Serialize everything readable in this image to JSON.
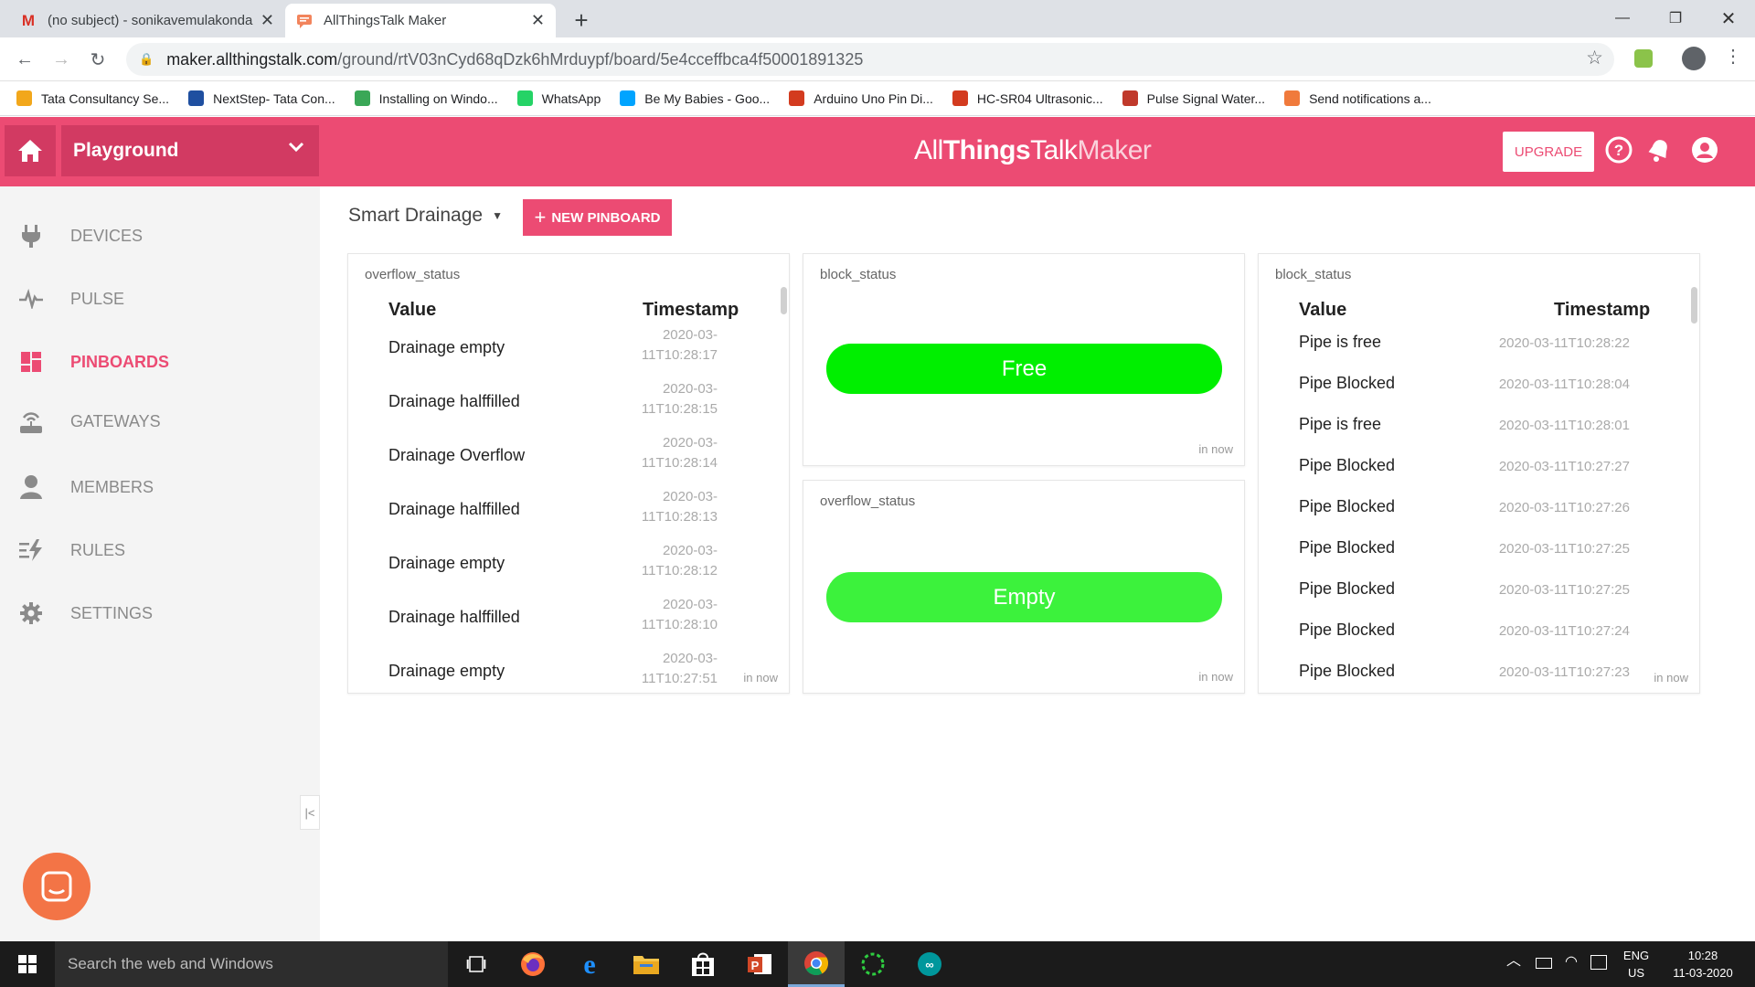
{
  "browser": {
    "tabs": [
      {
        "title": "(no subject) - sonikavemulakonda",
        "icon": "gmail-icon"
      },
      {
        "title": "AllThingsTalk Maker",
        "icon": "allthingstalk-icon"
      }
    ],
    "new_tab": "+",
    "url_host": "maker.allthingstalk.com",
    "url_path": "/ground/rtV03nCyd68qDzk6hMrduypf/board/5e4cceffbca4f50001891325",
    "bookmarks": [
      {
        "label": "Tata Consultancy Se...",
        "color": "#f2a71b"
      },
      {
        "label": "NextStep- Tata Con...",
        "color": "#1f4fa0"
      },
      {
        "label": "Installing on Windo...",
        "color": "#3aa757"
      },
      {
        "label": "WhatsApp",
        "color": "#25d366"
      },
      {
        "label": "Be My Babies - Goo...",
        "color": "#00a4ff"
      },
      {
        "label": "Arduino Uno Pin Di...",
        "color": "#d33b1f"
      },
      {
        "label": "HC-SR04 Ultrasonic...",
        "color": "#d33b1f"
      },
      {
        "label": "Pulse Signal Water...",
        "color": "#c0392b"
      },
      {
        "label": "Send notifications a...",
        "color": "#f07a3c"
      }
    ]
  },
  "header": {
    "ground": "Playground",
    "brand_a": "All",
    "brand_b": "Things",
    "brand_c": "Talk",
    "brand_d": "Maker",
    "upgrade": "UPGRADE",
    "accent": "#ec4b73"
  },
  "sidebar": {
    "items": [
      {
        "label": "DEVICES",
        "icon": "plug-icon"
      },
      {
        "label": "PULSE",
        "icon": "pulse-icon"
      },
      {
        "label": "PINBOARDS",
        "icon": "pinboards-icon"
      },
      {
        "label": "GATEWAYS",
        "icon": "gateway-icon"
      },
      {
        "label": "MEMBERS",
        "icon": "person-icon"
      },
      {
        "label": "RULES",
        "icon": "rules-icon"
      },
      {
        "label": "SETTINGS",
        "icon": "gear-icon"
      }
    ],
    "collapse": "|<"
  },
  "board": {
    "name": "Smart Drainage",
    "new_pinboard": "NEW PINBOARD"
  },
  "cards": {
    "overflow_table": {
      "title": "overflow_status",
      "col_value": "Value",
      "col_time": "Timestamp",
      "rows": [
        {
          "v": "Drainage empty",
          "t1": "2020-03-",
          "t2": "11T10:28:17"
        },
        {
          "v": "Drainage halffilled",
          "t1": "2020-03-",
          "t2": "11T10:28:15"
        },
        {
          "v": "Drainage Overflow",
          "t1": "2020-03-",
          "t2": "11T10:28:14"
        },
        {
          "v": "Drainage halffilled",
          "t1": "2020-03-",
          "t2": "11T10:28:13"
        },
        {
          "v": "Drainage empty",
          "t1": "2020-03-",
          "t2": "11T10:28:12"
        },
        {
          "v": "Drainage halffilled",
          "t1": "2020-03-",
          "t2": "11T10:28:10"
        },
        {
          "v": "Drainage empty",
          "t1": "2020-03-",
          "t2": "11T10:27:51"
        }
      ],
      "updated": "in now"
    },
    "block_label": {
      "title": "block_status",
      "value": "Free",
      "color": "#00ef00",
      "updated": "in now"
    },
    "overflow_label": {
      "title": "overflow_status",
      "value": "Empty",
      "color": "#3cf23c",
      "updated": "in now"
    },
    "block_table": {
      "title": "block_status",
      "col_value": "Value",
      "col_time": "Timestamp",
      "rows": [
        {
          "v": "Pipe is free",
          "t": "2020-03-11T10:28:22"
        },
        {
          "v": "Pipe Blocked",
          "t": "2020-03-11T10:28:04"
        },
        {
          "v": "Pipe is free",
          "t": "2020-03-11T10:28:01"
        },
        {
          "v": "Pipe Blocked",
          "t": "2020-03-11T10:27:27"
        },
        {
          "v": "Pipe Blocked",
          "t": "2020-03-11T10:27:26"
        },
        {
          "v": "Pipe Blocked",
          "t": "2020-03-11T10:27:25"
        },
        {
          "v": "Pipe Blocked",
          "t": "2020-03-11T10:27:25"
        },
        {
          "v": "Pipe Blocked",
          "t": "2020-03-11T10:27:24"
        },
        {
          "v": "Pipe Blocked",
          "t": "2020-03-11T10:27:23"
        }
      ],
      "updated": "in now"
    }
  },
  "taskbar": {
    "search_placeholder": "Search the web and Windows",
    "lang1": "ENG",
    "lang2": "US",
    "time": "10:28",
    "date": "11-03-2020"
  }
}
